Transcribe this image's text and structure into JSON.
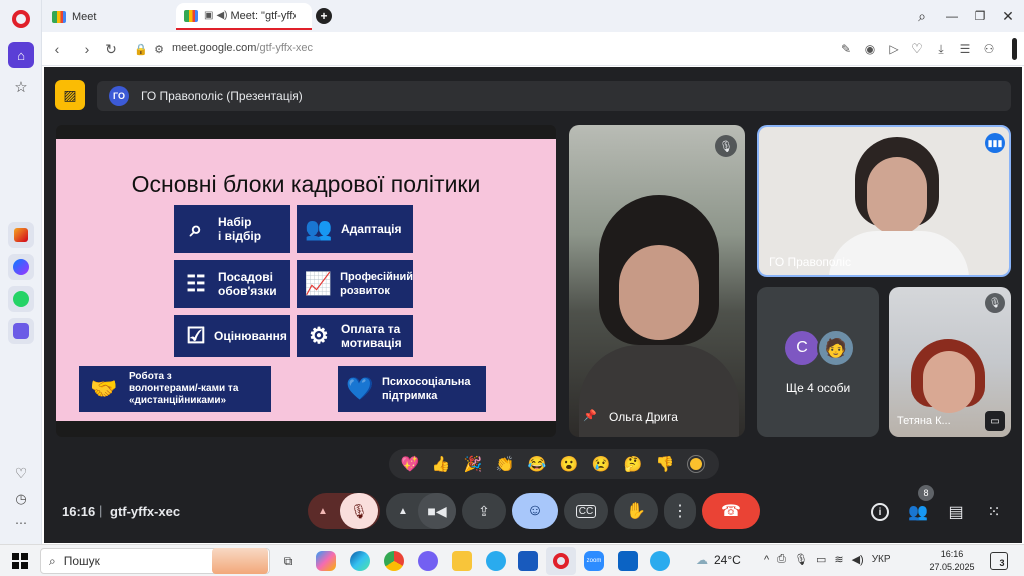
{
  "browser": {
    "tabs": [
      {
        "label": "Meet"
      },
      {
        "label": "Meet: \"gtf-yffx-xec"
      }
    ],
    "new_tab": "+",
    "url_domain": "meet.google.com",
    "url_path": "/gtf-yffx-xec"
  },
  "meeting": {
    "title": "ГО Правополіс (Презентація)",
    "avatar_letter": "ГО",
    "code": "gtf-yffx-xec",
    "time": "16:16",
    "participant_count": "8"
  },
  "slide": {
    "title": "Основні блоки кадрової політики",
    "blocks": [
      {
        "line1": "Набір",
        "line2": "і відбір"
      },
      {
        "line1": "Адаптація",
        "line2": ""
      },
      {
        "line1": "Посадові",
        "line2": "обов'язки"
      },
      {
        "line1": "Професійний",
        "line2": "розвиток"
      },
      {
        "line1": "Оцінювання",
        "line2": ""
      },
      {
        "line1": "Оплата та",
        "line2": "мотивація"
      },
      {
        "line1": "Робота з",
        "line2": "волонтерами/-ками та",
        "line3": "«дистанційниками»"
      },
      {
        "line1": "Психосоціальна",
        "line2": "підтримка"
      }
    ]
  },
  "participants": {
    "pinned": "Ольга Дрига",
    "presenter": "ГО Правополіс",
    "others_label": "Ще 4 особи",
    "others_letter": "C",
    "bottom_right": "Тетяна К..."
  },
  "reactions": [
    "💖",
    "👍",
    "🎉",
    "👏",
    "😂",
    "😮",
    "😢",
    "🤔",
    "👎"
  ],
  "taskbar": {
    "search": "Пошук",
    "weather": "24°C",
    "lang": "УКР",
    "time": "16:16",
    "date": "27.05.2025",
    "badge": "3"
  },
  "colors": {
    "meet_bg": "#202124",
    "slide_bg": "#f7c5dc",
    "block_bg": "#1a2a6c",
    "end_call": "#ea4335",
    "reaction_btn": "#a8c7fa"
  }
}
